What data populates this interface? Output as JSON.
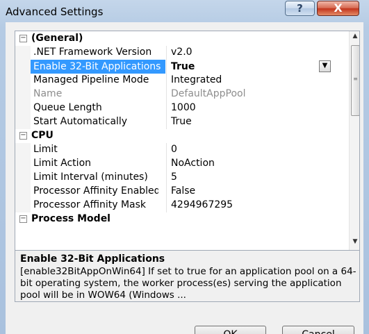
{
  "window": {
    "title": "Advanced Settings",
    "help_label": "?",
    "close_label": "X"
  },
  "grid": {
    "rows": [
      {
        "type": "category",
        "label": "(General)",
        "expander": "−"
      },
      {
        "type": "prop",
        "name": ".NET Framework Version",
        "value": "v2.0"
      },
      {
        "type": "prop",
        "name": "Enable 32-Bit Applications",
        "value": "True",
        "selected": true
      },
      {
        "type": "prop",
        "name": "Managed Pipeline Mode",
        "value": "Integrated"
      },
      {
        "type": "prop",
        "name": "Name",
        "value": "DefaultAppPool",
        "disabled": true
      },
      {
        "type": "prop",
        "name": "Queue Length",
        "value": "1000"
      },
      {
        "type": "prop",
        "name": "Start Automatically",
        "value": "True"
      },
      {
        "type": "category",
        "label": "CPU",
        "expander": "−"
      },
      {
        "type": "prop",
        "name": "Limit",
        "value": "0"
      },
      {
        "type": "prop",
        "name": "Limit Action",
        "value": "NoAction"
      },
      {
        "type": "prop",
        "name": "Limit Interval (minutes)",
        "value": "5"
      },
      {
        "type": "prop",
        "name": "Processor Affinity Enabled",
        "value": "False"
      },
      {
        "type": "prop",
        "name": "Processor Affinity Mask",
        "value": "4294967295"
      },
      {
        "type": "category",
        "label": "Process Model",
        "expander": "−"
      }
    ],
    "dropdown_glyph": "▼"
  },
  "description": {
    "title": "Enable 32-Bit Applications",
    "text": "[enable32BitAppOnWin64] If set to true for an application pool on a 64-bit operating system, the worker process(es) serving the application pool will be in WOW64 (Windows ..."
  },
  "buttons": {
    "ok": "OK",
    "cancel": "Cancel"
  },
  "colors": {
    "selection": "#3399ff",
    "close_button": "#c2341c"
  }
}
